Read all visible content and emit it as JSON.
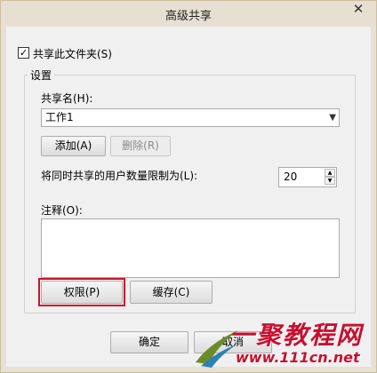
{
  "window": {
    "title": "高级共享",
    "close_glyph": "✕"
  },
  "share_checkbox": {
    "label": "共享此文件夹(S)",
    "checked": true,
    "check_glyph": "✓"
  },
  "settings": {
    "legend": "设置",
    "share_name_label": "共享名(H):",
    "share_name_value": "工作1",
    "add_button": "添加(A)",
    "delete_button": "删除(R)",
    "user_limit_label": "将同时共享的用户数量限制为(L):",
    "user_limit_value": "20",
    "comment_label": "注释(O):",
    "comment_value": "",
    "permissions_button": "权限(P)",
    "cache_button": "缓存(C)"
  },
  "footer": {
    "ok_button": "确定",
    "cancel_button": "取消"
  },
  "watermark": {
    "brand": "一聚教程网",
    "url": "www.111cn.net"
  },
  "colors": {
    "highlight": "#d0102b",
    "watermark": "#c8102e"
  }
}
